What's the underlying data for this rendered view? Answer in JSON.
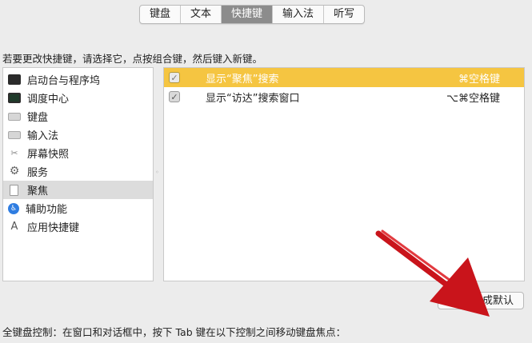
{
  "tabs": [
    {
      "label": "键盘",
      "active": false
    },
    {
      "label": "文本",
      "active": false
    },
    {
      "label": "快捷键",
      "active": true
    },
    {
      "label": "输入法",
      "active": false
    },
    {
      "label": "听写",
      "active": false
    }
  ],
  "instruction": "若要更改快捷键，请选择它，点按组合键，然后键入新键。",
  "categories": [
    {
      "label": "启动台与程序坞",
      "icon": "launchpad-icon"
    },
    {
      "label": "调度中心",
      "icon": "mission-control-icon"
    },
    {
      "label": "键盘",
      "icon": "keyboard-icon"
    },
    {
      "label": "输入法",
      "icon": "input-source-icon"
    },
    {
      "label": "屏幕快照",
      "icon": "screenshot-icon"
    },
    {
      "label": "服务",
      "icon": "gear-icon"
    },
    {
      "label": "聚焦",
      "icon": "spotlight-icon",
      "selected": true
    },
    {
      "label": "辅助功能",
      "icon": "accessibility-icon"
    },
    {
      "label": "应用快捷键",
      "icon": "app-shortcuts-icon"
    }
  ],
  "shortcuts": [
    {
      "label": "显示“聚焦”搜索",
      "key": "⌘空格键",
      "checked": true,
      "selected": true
    },
    {
      "label": "显示“访达”搜索窗口",
      "key": "⌥⌘空格键",
      "checked": true,
      "selected": false
    }
  ],
  "restore_button": "恢复成默认",
  "footer": "全键盘控制：在窗口和对话框中，按下 Tab 键在以下控制之间移动键盘焦点：",
  "colors": {
    "selection": "#f5c541",
    "active_tab": "#8c8c8c",
    "annotation_arrow": "#c9141b"
  }
}
